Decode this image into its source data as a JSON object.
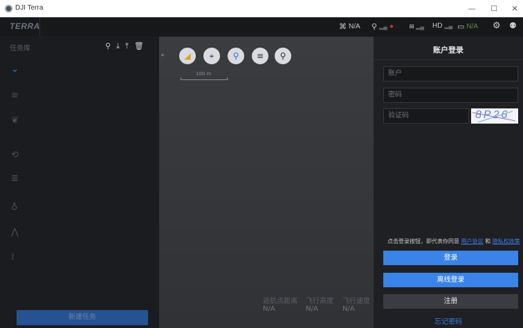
{
  "window": {
    "title": "DJI Terra",
    "minimize": "—",
    "maximize": "☐",
    "close": "✕"
  },
  "toolbar": {
    "brand": "TERRA",
    "status": [
      {
        "icon": "link-icon",
        "glyph": "⌘",
        "text": "N/A"
      },
      {
        "icon": "satellite-icon",
        "glyph": "⚲",
        "text": ""
      },
      {
        "icon": "rc-icon",
        "glyph": "⩎",
        "text": ""
      },
      {
        "icon": "hd-signal-icon",
        "glyph": "",
        "text": "HD"
      },
      {
        "icon": "battery-icon",
        "glyph": "▭",
        "text": "N/A"
      }
    ],
    "settings_icon": "gear-icon",
    "account_icon": "user-icon"
  },
  "left_panel": {
    "title": "任务库",
    "tools": [
      "search-icon",
      "import-icon",
      "export-icon",
      "delete-icon"
    ],
    "sidebar_icons": [
      {
        "name": "mission-all-icon",
        "glyph": "⌄",
        "active": true
      },
      {
        "name": "mapping-2d-icon",
        "glyph": "≋"
      },
      {
        "name": "mapping-3d-icon",
        "glyph": "❦"
      },
      {
        "name": "waypoint-icon",
        "glyph": "⟲"
      },
      {
        "name": "area-icon",
        "glyph": "≣"
      },
      {
        "name": "oblique-icon",
        "glyph": "♁"
      },
      {
        "name": "corridor-icon",
        "glyph": "⋀"
      },
      {
        "name": "lidar-icon",
        "glyph": "⟟"
      }
    ],
    "new_task_label": "新建任务"
  },
  "map": {
    "collapse_label": "«",
    "controls": [
      {
        "name": "compass-icon",
        "glyph": "◢"
      },
      {
        "name": "locate-icon",
        "glyph": "⌖"
      },
      {
        "name": "pin-icon",
        "glyph": "⚲"
      },
      {
        "name": "list-icon",
        "glyph": "≡"
      },
      {
        "name": "search-map-icon",
        "glyph": "⚲"
      }
    ],
    "scale_label": "100 m",
    "stats": [
      {
        "label": "返航点距离",
        "value": "N/A"
      },
      {
        "label": "飞行高度",
        "value": "N/A"
      },
      {
        "label": "飞行速度",
        "value": "N/A"
      }
    ]
  },
  "login": {
    "title": "账户登录",
    "account_placeholder": "账户",
    "password_placeholder": "密码",
    "captcha_placeholder": "验证码",
    "captcha_text": "8P26",
    "terms_prefix": "点击登录按钮，即代表你同意",
    "terms_user_agreement": "用户协议",
    "terms_and": "和",
    "terms_privacy": "隐私权政策",
    "login_label": "登录",
    "offline_label": "离线登录",
    "register_label": "注册",
    "forgot_label": "忘记密码"
  },
  "colors": {
    "accent": "#3a83e8",
    "link": "#3d7be0",
    "panel_bg": "#1f2023",
    "map_bg": "#3a3c3f"
  }
}
